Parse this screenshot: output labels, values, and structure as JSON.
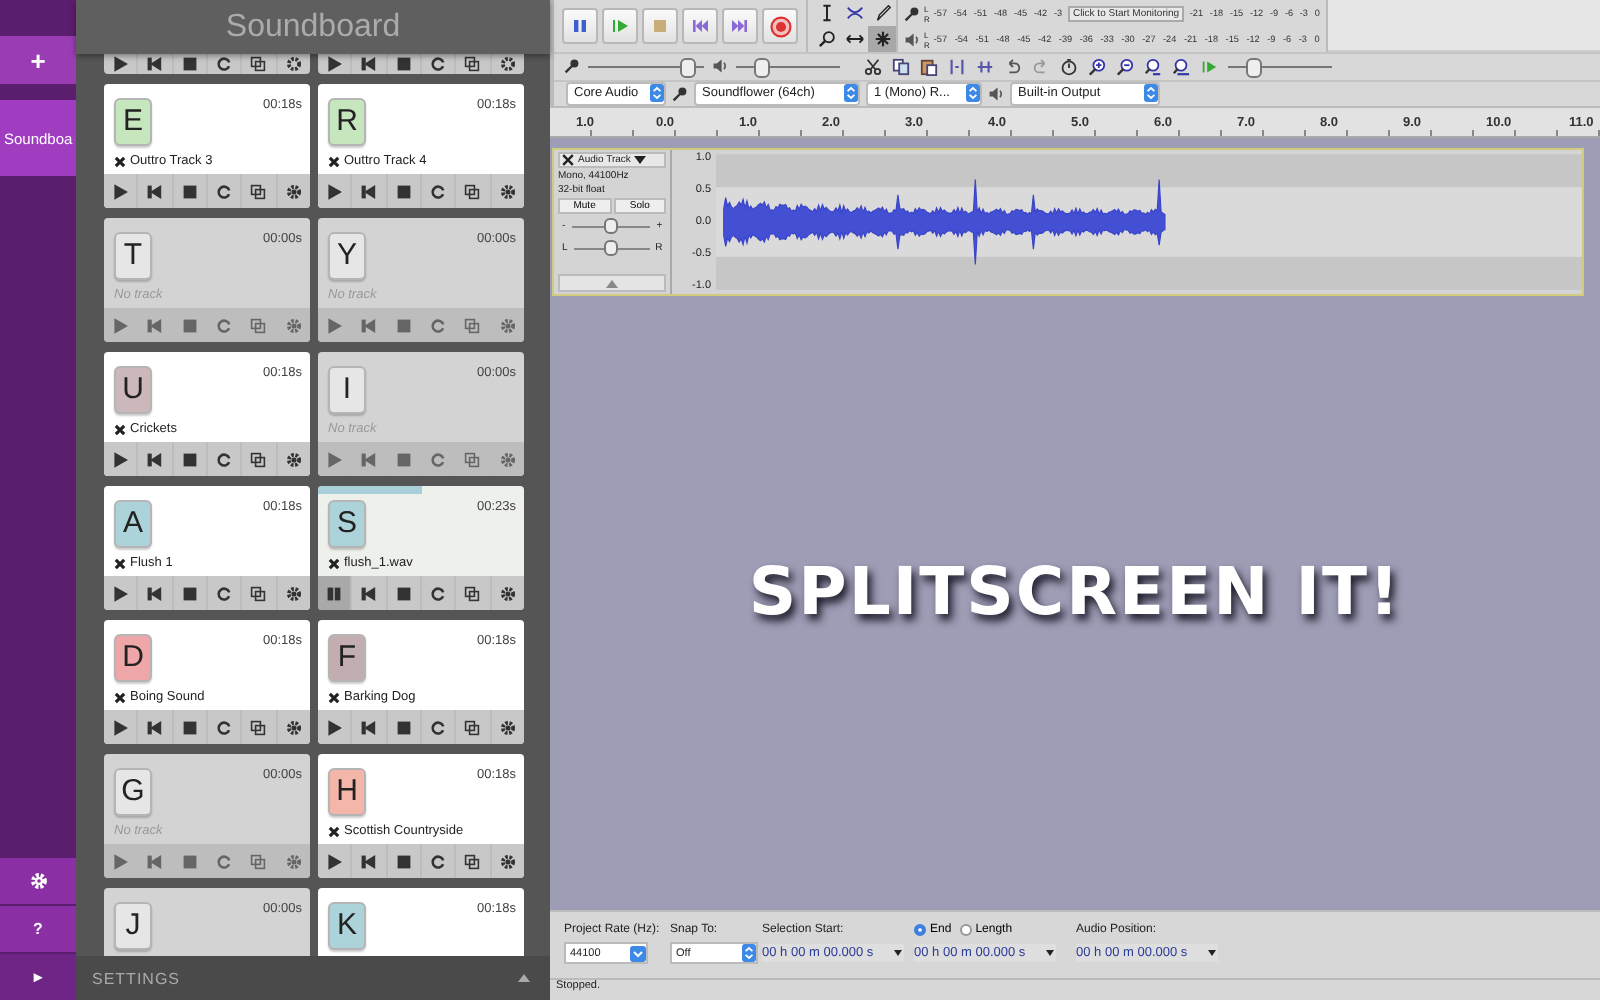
{
  "rail": {
    "add_button": "+",
    "tabs": [
      {
        "label": "Soundboa",
        "selected": true
      }
    ],
    "help_button": "?",
    "collapse_button": "▸"
  },
  "soundboard": {
    "title": "Soundboard",
    "cards": [
      {
        "kind": "partial"
      },
      {
        "kind": "partial"
      },
      {
        "kind": "loaded",
        "key": "E",
        "color": "#c6e6bd",
        "time": "00:18s",
        "track": "Outtro Track 3",
        "playing": false
      },
      {
        "kind": "loaded",
        "key": "R",
        "color": "#c6e6bd",
        "time": "00:18s",
        "track": "Outtro Track 4",
        "playing": false
      },
      {
        "kind": "empty",
        "key": "T",
        "time": "00:00s",
        "track": "No track",
        "playing": false
      },
      {
        "kind": "empty",
        "key": "Y",
        "time": "00:00s",
        "track": "No track",
        "playing": false
      },
      {
        "kind": "loaded",
        "key": "U",
        "color": "#ccb7bb",
        "time": "00:18s",
        "track": "Crickets",
        "playing": false
      },
      {
        "kind": "empty",
        "key": "I",
        "time": "00:00s",
        "track": "No track",
        "playing": false
      },
      {
        "kind": "loaded",
        "key": "A",
        "color": "#acd3da",
        "time": "00:18s",
        "track": "Flush 1",
        "playing": false
      },
      {
        "kind": "loaded",
        "key": "S",
        "color": "#acd3da",
        "time": "00:23s",
        "track": "flush_1.wav",
        "playing": true,
        "level": 0.5
      },
      {
        "kind": "loaded",
        "key": "D",
        "color": "#eea6a8",
        "time": "00:18s",
        "track": "Boing Sound",
        "playing": false
      },
      {
        "kind": "loaded",
        "key": "F",
        "color": "#c2aeb1",
        "time": "00:18s",
        "track": "Barking Dog",
        "playing": false
      },
      {
        "kind": "empty",
        "key": "G",
        "time": "00:00s",
        "track": "No track",
        "playing": false
      },
      {
        "kind": "loaded",
        "key": "H",
        "color": "#f5b6aa",
        "time": "00:18s",
        "track": "Scottish Countryside",
        "playing": false
      },
      {
        "kind": "empty",
        "key": "J",
        "time": "00:00s",
        "playing": false
      },
      {
        "kind": "loaded",
        "key": "K",
        "color": "#acd3da",
        "time": "00:18s",
        "playing": false
      }
    ],
    "settings": "SETTINGS"
  },
  "audacity": {
    "tools": [
      {
        "kind": "ibeam",
        "selected": false
      },
      {
        "kind": "envelope",
        "selected": false
      },
      {
        "kind": "pencil",
        "selected": false
      },
      {
        "kind": "zoom",
        "selected": false
      },
      {
        "kind": "timeshift",
        "selected": false
      },
      {
        "kind": "multi",
        "selected": true
      }
    ],
    "meters": [
      {
        "kind": "record",
        "channels": [
          "L",
          "R"
        ],
        "ticks": [
          "-57",
          "-54",
          "-51",
          "-48",
          "-45",
          "-42",
          "-3"
        ],
        "hint": "Click to Start Monitoring",
        "ticks_after": [
          "-21",
          "-18",
          "-15",
          "-12",
          "-9",
          "-6",
          "-3",
          "0"
        ]
      },
      {
        "kind": "playback",
        "channels": [
          "L",
          "R"
        ],
        "ticks": [
          "-57",
          "-54",
          "-51",
          "-48",
          "-45",
          "-42",
          "-39",
          "-36",
          "-33",
          "-30",
          "-27",
          "-24",
          "-21",
          "-18",
          "-15",
          "-12",
          "-9",
          "-6",
          "-3",
          "0"
        ]
      }
    ],
    "sliders": [
      {
        "kind": "input",
        "level": 0.92
      },
      {
        "kind": "output",
        "level": 0.2
      }
    ],
    "speed": {
      "level": 0.2
    },
    "devices": [
      {
        "kind": "host",
        "value": "Core Audio"
      },
      {
        "kind": "input",
        "value": "Soundflower (64ch)"
      },
      {
        "kind": "channels",
        "value": "1 (Mono) R..."
      },
      {
        "kind": "output",
        "value": "Built-in Output"
      }
    ],
    "ruler": [
      "1.0",
      "0.0",
      "1.0",
      "2.0",
      "3.0",
      "4.0",
      "5.0",
      "6.0",
      "7.0",
      "8.0",
      "9.0",
      "10.0",
      "11.0"
    ],
    "track": {
      "name": "Audio Track",
      "info": [
        "Mono, 44100Hz",
        "32-bit float"
      ],
      "mute": "Mute",
      "solo": "Solo",
      "gain": [
        "-",
        "+"
      ],
      "pan": [
        "L",
        "R"
      ],
      "gain_slider": {
        "level": 0.5
      },
      "pan_slider": {
        "level": 0.5
      },
      "scale": [
        "1.0",
        "0.5",
        "0.0",
        "-0.5",
        "-1.0"
      ]
    },
    "overlay": "SPLITSCREEN IT!",
    "selection": {
      "rate_label": "Project Rate (Hz):",
      "rate": "44100",
      "snap_label": "Snap To:",
      "snap": "Off",
      "start_label": "Selection Start:",
      "modes": [
        {
          "label": "End",
          "selected": true
        },
        {
          "label": "Length",
          "selected": false
        }
      ],
      "position_label": "Audio Position:",
      "times": [
        "00 h 00 m 00.000 s",
        "00 h 00 m 00.000 s",
        "00 h 00 m 00.000 s"
      ]
    },
    "status": "Stopped."
  }
}
